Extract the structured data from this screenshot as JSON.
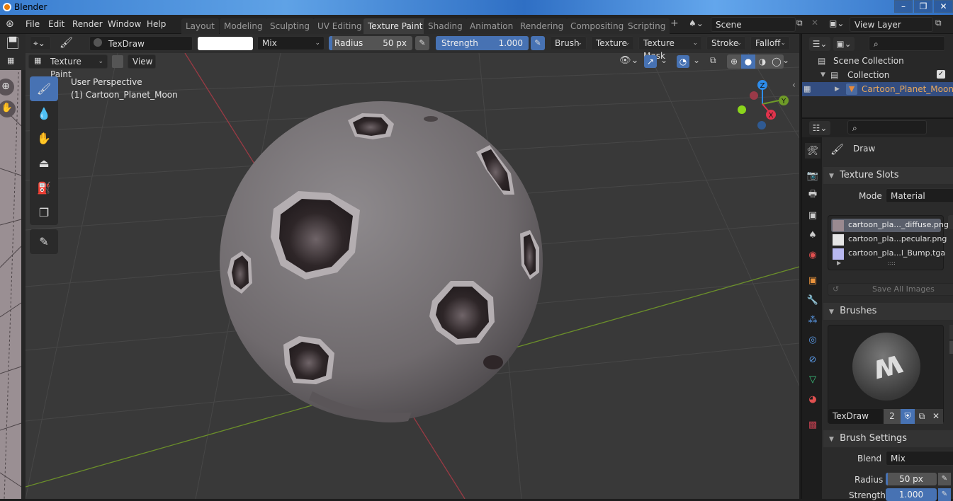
{
  "window": {
    "title": "Blender",
    "controls": {
      "minimize": "–",
      "restore": "❐",
      "close": "✕"
    }
  },
  "menubar": {
    "items": [
      "File",
      "Edit",
      "Render",
      "Window",
      "Help"
    ],
    "workspaces": [
      "Layout",
      "Modeling",
      "Sculpting",
      "UV Editing",
      "Texture Paint",
      "Shading",
      "Animation",
      "Rendering",
      "Compositing",
      "Scripting"
    ],
    "active_workspace": "Texture Paint",
    "add_workspace": "+",
    "scene_label": "Scene",
    "view_layer_label": "View Layer"
  },
  "tool_header": {
    "brush_name": "TexDraw",
    "color_value": "#ffffff",
    "blend_mode": "Mix",
    "radius_label": "Radius",
    "radius_value": "50 px",
    "radius_fraction": 0.02,
    "strength_label": "Strength",
    "strength_value": "1.000",
    "strength_fraction": 1.0,
    "dropdowns": [
      "Brush",
      "Texture",
      "Texture Mask",
      "Stroke",
      "Falloff"
    ]
  },
  "viewport_header": {
    "mode": "Texture Paint",
    "view_menu": "View"
  },
  "viewport": {
    "perspective_label": "User Perspective",
    "object_label": "(1) Cartoon_Planet_Moon",
    "gizmo": {
      "z": "Z",
      "y": "Y",
      "x": "X"
    },
    "axis_colors": {
      "x": "#e0334c",
      "y": "#6e9a28",
      "z": "#2d8ceb",
      "x_neg": "#9a3a48",
      "y_neg": "#8bd51c",
      "z_neg": "#2f5a92"
    }
  },
  "tools": [
    {
      "name": "draw",
      "icon": "brush-icon",
      "active": true
    },
    {
      "name": "soften",
      "icon": "drop-icon",
      "active": false
    },
    {
      "name": "smear",
      "icon": "smear-icon",
      "active": false
    },
    {
      "name": "clone",
      "icon": "stamp-icon",
      "active": false
    },
    {
      "name": "fill",
      "icon": "bucket-icon",
      "active": false
    },
    {
      "name": "mask",
      "icon": "mask-icon",
      "active": false
    },
    {
      "name": "annotate",
      "icon": "pencil-icon",
      "active": false
    }
  ],
  "outliner": {
    "scene_collection": "Scene Collection",
    "collection": "Collection",
    "object": "Cartoon_Planet_Moon"
  },
  "properties": {
    "tool_name": "Draw",
    "texture_slots": {
      "title": "Texture Slots",
      "mode_label": "Mode",
      "mode_value": "Material",
      "slots": [
        {
          "name": "cartoon_pla..._diffuse.png",
          "swatch": "#9a8a90",
          "selected": true
        },
        {
          "name": "cartoon_pla...pecular.png",
          "swatch": "#e6e6e6",
          "selected": false
        },
        {
          "name": "cartoon_pla...l_Bump.tga",
          "swatch": "#b8b8f0",
          "selected": false
        }
      ],
      "save_all": "Save All Images"
    },
    "brushes": {
      "title": "Brushes",
      "brush_name": "TexDraw",
      "users": "2"
    },
    "brush_settings": {
      "title": "Brush Settings",
      "blend_label": "Blend",
      "blend_value": "Mix",
      "radius_label": "Radius",
      "radius_value": "50 px",
      "strength_label": "Strength",
      "strength_value": "1.000"
    }
  }
}
